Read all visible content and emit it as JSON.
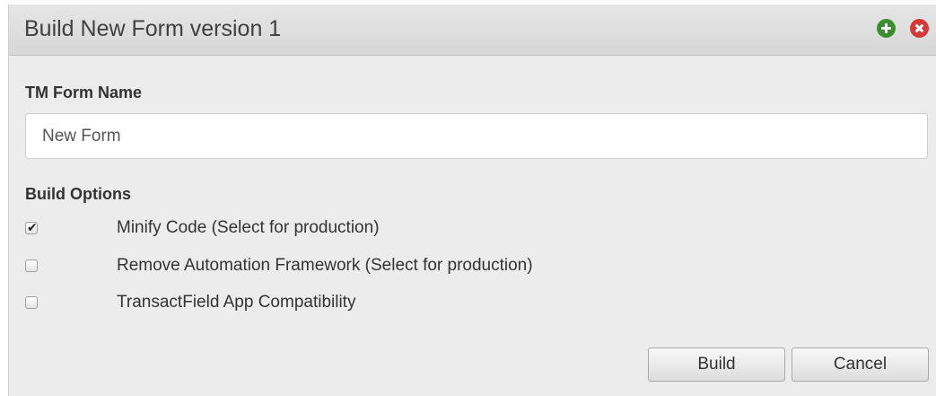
{
  "dialog": {
    "title": "Build New Form version 1",
    "icons": {
      "add": "plus-circle-icon",
      "close": "close-circle-icon"
    },
    "colors": {
      "add_icon": "#3b8f2f",
      "close_icon": "#d2393a"
    }
  },
  "form": {
    "name_label": "TM Form Name",
    "name_value": "New Form",
    "options_label": "Build Options",
    "options": [
      {
        "label": "Minify Code (Select for production)",
        "checked": true
      },
      {
        "label": "Remove Automation Framework (Select for production)",
        "checked": false
      },
      {
        "label": "TransactField App Compatibility",
        "checked": false
      }
    ]
  },
  "buttons": {
    "build": "Build",
    "cancel": "Cancel"
  }
}
